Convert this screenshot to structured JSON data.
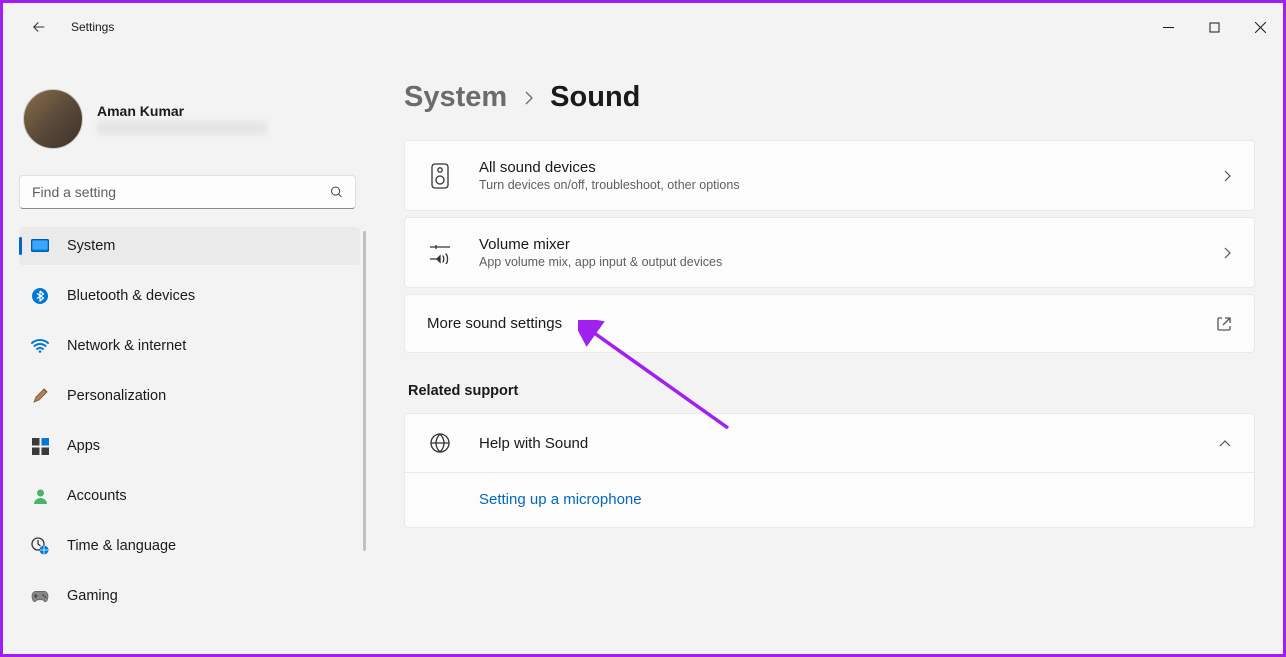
{
  "app": {
    "title": "Settings"
  },
  "user": {
    "name": "Aman Kumar"
  },
  "search": {
    "placeholder": "Find a setting"
  },
  "sidebar": {
    "items": [
      {
        "label": "System"
      },
      {
        "label": "Bluetooth & devices"
      },
      {
        "label": "Network & internet"
      },
      {
        "label": "Personalization"
      },
      {
        "label": "Apps"
      },
      {
        "label": "Accounts"
      },
      {
        "label": "Time & language"
      },
      {
        "label": "Gaming"
      }
    ]
  },
  "breadcrumb": {
    "parent": "System",
    "current": "Sound"
  },
  "panels": {
    "all_devices": {
      "title": "All sound devices",
      "sub": "Turn devices on/off, troubleshoot, other options"
    },
    "volume_mixer": {
      "title": "Volume mixer",
      "sub": "App volume mix, app input & output devices"
    },
    "more": {
      "title": "More sound settings"
    }
  },
  "related": {
    "heading": "Related support",
    "help_title": "Help with Sound",
    "help_link": "Setting up a microphone"
  }
}
